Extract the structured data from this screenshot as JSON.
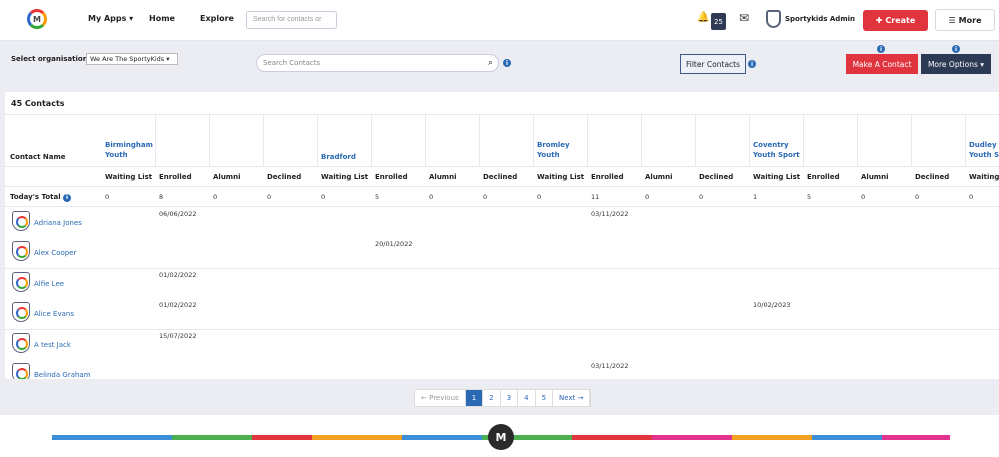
{
  "topbar": {
    "logo_letter": "M",
    "nav": [
      "My Apps ▾",
      "Home",
      "Explore"
    ],
    "search_placeholder": "Search for contacts or",
    "notifications_count": "25",
    "user_name": "Sportykids Admin",
    "create_label": "Create",
    "more_label": "More"
  },
  "toolbar": {
    "org_label": "Select organisation:",
    "org_value": "We Are The SportyKids",
    "search_placeholder": "Search Contacts",
    "filter_label": "Filter Contacts",
    "make_contact_label": "Make A Contact",
    "more_options_label": "More Options ▾"
  },
  "table": {
    "title": "45 Contacts",
    "contact_name_header": "Contact Name",
    "groups": [
      {
        "name": "Birmingham\nYouth"
      },
      {
        "name": "Bradford"
      },
      {
        "name": "Bromley\nYouth"
      },
      {
        "name": "Coventry\nYouth Sport"
      },
      {
        "name": "Dudley\nYouth Sp"
      }
    ],
    "subheaders": [
      "Waiting List",
      "Enrolled",
      "Alumni",
      "Declined",
      "Waiting List",
      "Enrolled",
      "Alumni",
      "Declined",
      "Waiting List",
      "Enrolled",
      "Alumni",
      "Declined",
      "Waiting List",
      "Enrolled",
      "Alumni",
      "Declined",
      "Waiting"
    ],
    "todays_total_label": "Today's Total",
    "todays_totals": [
      "0",
      "8",
      "0",
      "0",
      "0",
      "5",
      "0",
      "0",
      "0",
      "11",
      "0",
      "0",
      "1",
      "5",
      "0",
      "0",
      "0"
    ],
    "rows": [
      {
        "name": "Adriana Jones",
        "cells": [
          {
            "col": 1,
            "value": "06/06/2022"
          },
          {
            "col": 9,
            "value": "03/11/2022"
          }
        ]
      },
      {
        "name": "Alex Cooper",
        "cells": [
          {
            "col": 5,
            "value": "20/01/2022"
          }
        ]
      },
      {
        "name": "Alfie Lee",
        "cells": [
          {
            "col": 1,
            "value": "01/02/2022"
          }
        ]
      },
      {
        "name": "Alice Evans",
        "cells": [
          {
            "col": 1,
            "value": "01/02/2022"
          },
          {
            "col": 12,
            "value": "10/02/2023"
          }
        ]
      },
      {
        "name": "A test Jack",
        "cells": [
          {
            "col": 1,
            "value": "15/07/2022"
          }
        ]
      },
      {
        "name": "Belinda Graham",
        "cells": [
          {
            "col": 9,
            "value": "03/11/2022"
          }
        ]
      }
    ]
  },
  "pagination": {
    "items": [
      "← Previous",
      "1",
      "2",
      "3",
      "4",
      "5",
      "Next →"
    ],
    "active_page": "1"
  },
  "footer": {
    "logo_letter": "M"
  },
  "colors": {
    "accent_red": "#e0343f",
    "navy": "#2c3a55",
    "link_blue": "#2a6ab5"
  }
}
